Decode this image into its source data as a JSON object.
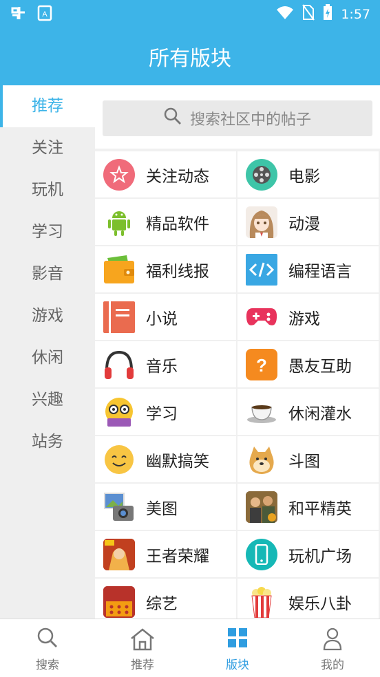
{
  "status_bar": {
    "time": "1:57",
    "colors": {
      "bar": "#3db4e8"
    }
  },
  "header": {
    "title": "所有版块"
  },
  "sidebar": {
    "items": [
      {
        "label": "推荐",
        "active": true
      },
      {
        "label": "关注"
      },
      {
        "label": "玩机"
      },
      {
        "label": "学习"
      },
      {
        "label": "影音"
      },
      {
        "label": "游戏"
      },
      {
        "label": "休闲"
      },
      {
        "label": "兴趣"
      },
      {
        "label": "站务"
      }
    ]
  },
  "search": {
    "placeholder": "搜索社区中的帖子"
  },
  "boards": [
    {
      "label": "关注动态",
      "icon": "star-circle-icon"
    },
    {
      "label": "电影",
      "icon": "film-reel-icon"
    },
    {
      "label": "精品软件",
      "icon": "android-icon"
    },
    {
      "label": "动漫",
      "icon": "anime-girl-icon"
    },
    {
      "label": "福利线报",
      "icon": "wallet-icon"
    },
    {
      "label": "编程语言",
      "icon": "code-icon"
    },
    {
      "label": "小说",
      "icon": "book-icon"
    },
    {
      "label": "游戏",
      "icon": "gamepad-icon"
    },
    {
      "label": "音乐",
      "icon": "headphones-icon"
    },
    {
      "label": "愚友互助",
      "icon": "question-icon"
    },
    {
      "label": "学习",
      "icon": "nerd-face-icon"
    },
    {
      "label": "休闲灌水",
      "icon": "coffee-cup-icon"
    },
    {
      "label": "幽默搞笑",
      "icon": "smile-face-icon"
    },
    {
      "label": "斗图",
      "icon": "doge-icon"
    },
    {
      "label": "美图",
      "icon": "camera-photos-icon"
    },
    {
      "label": "和平精英",
      "icon": "pubg-game-icon"
    },
    {
      "label": "王者荣耀",
      "icon": "honor-of-kings-icon"
    },
    {
      "label": "玩机广场",
      "icon": "phone-icon"
    },
    {
      "label": "综艺",
      "icon": "theater-icon"
    },
    {
      "label": "娱乐八卦",
      "icon": "popcorn-icon"
    }
  ],
  "tabbar": {
    "items": [
      {
        "label": "搜索",
        "icon": "search-icon"
      },
      {
        "label": "推荐",
        "icon": "home-icon"
      },
      {
        "label": "版块",
        "icon": "grid-icon",
        "active": true
      },
      {
        "label": "我的",
        "icon": "user-icon"
      }
    ]
  },
  "colors": {
    "accent": "#3db4e8",
    "tab_active": "#2f9de0"
  }
}
